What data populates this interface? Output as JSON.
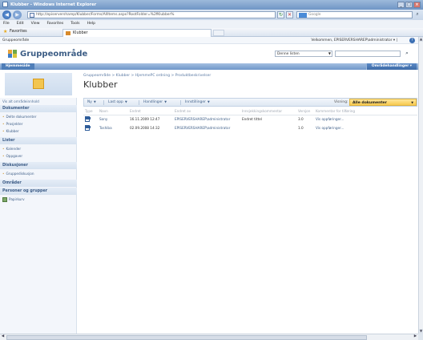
{
  "window": {
    "title": "Klubber - Windows Internet Explorer",
    "buttons": [
      "_",
      "□",
      "×"
    ]
  },
  "address": {
    "url": "http://episerversharep/Klubber/Forms/AllItems.aspx?RootFolder=%2fKlubber%",
    "search_placeholder": "Google",
    "refresh_glyph": "↻",
    "stop_glyph": "✕",
    "search_go_glyph": "⌕"
  },
  "menu": [
    "File",
    "Edit",
    "View",
    "Favorites",
    "Tools",
    "Help"
  ],
  "favbar": {
    "favorites": "Favorites",
    "tab_title": "Klubber"
  },
  "sharepoint": {
    "top_site": "Gruppeområde",
    "welcome": "Velkommen, EPISERVERSHAREP\\administrator ▾ |",
    "help_icon": "?",
    "site_title": "Gruppeområde",
    "search_scope": "Denne listen",
    "nav_home": "Hjemmeside",
    "site_actions": "Områdehandlinger ▾",
    "breadcrumb": "Gruppeområde > Klubber > HjemmePC ordning > Produktbeskrivelser",
    "page_title": "Klubber",
    "leftnav": {
      "view_all": "Vis alt områdeinnhold",
      "sections": [
        {
          "title": "Dokumenter",
          "items": [
            "Delte dokumenter",
            "Prosjekter",
            "Klubber"
          ]
        },
        {
          "title": "Lister",
          "items": [
            "Kalender",
            "Oppgaver"
          ]
        },
        {
          "title": "Diskusjoner",
          "items": [
            "Gruppediskusjon"
          ]
        },
        {
          "title": "Områder",
          "items": []
        },
        {
          "title": "Personer og grupper",
          "items": []
        }
      ],
      "recycle_bin": "Papirkurv"
    },
    "toolbar": {
      "new": "Ny",
      "upload": "Last opp",
      "actions": "Handlinger",
      "settings": "Innstillinger",
      "view_label": "Visning:",
      "view_value": "Alle dokumenter"
    },
    "table": {
      "columns": [
        "Type",
        "Navn",
        "Endret",
        "Endret av",
        "Innsjekkingskommentar",
        "Versjon",
        "Kommentar for tilføring"
      ],
      "rows": [
        {
          "name": "Sony",
          "modified": "16.11.2009 12:47",
          "modified_by": "EPISERVERSHAREP\\administrator",
          "comment": "Endret tittel",
          "version": "3.0",
          "link": "Vis oppføringer..."
        },
        {
          "name": "Toshiba",
          "modified": "02.09.2008 14:32",
          "modified_by": "EPISERVERSHAREP\\administrator",
          "comment": "",
          "version": "1.0",
          "link": "Vis oppføringer..."
        }
      ]
    }
  },
  "colors": {
    "accent": "#3c5d85",
    "view_selector": "#f7c94d",
    "nav_bar": "#6f97c9"
  }
}
